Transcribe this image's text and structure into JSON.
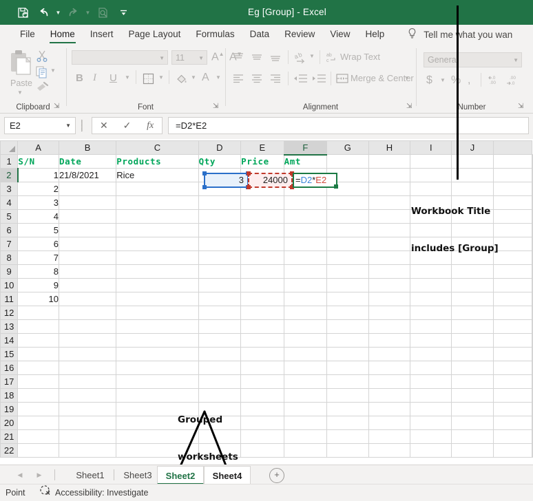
{
  "titlebar": {
    "title": "Eg [Group] - Excel",
    "qat": [
      {
        "name": "save-icon",
        "glyph": "save"
      },
      {
        "name": "undo-icon",
        "glyph": "undo"
      },
      {
        "name": "redo-icon",
        "glyph": "redo"
      },
      {
        "name": "print-preview-icon",
        "glyph": "preview"
      },
      {
        "name": "customize-qat-icon",
        "glyph": "more"
      }
    ]
  },
  "ribbon": {
    "tabs": [
      {
        "label": "File",
        "active": false
      },
      {
        "label": "Home",
        "active": true
      },
      {
        "label": "Insert",
        "active": false
      },
      {
        "label": "Page Layout",
        "active": false
      },
      {
        "label": "Formulas",
        "active": false
      },
      {
        "label": "Data",
        "active": false
      },
      {
        "label": "Review",
        "active": false
      },
      {
        "label": "View",
        "active": false
      },
      {
        "label": "Help",
        "active": false
      }
    ],
    "tellme": "Tell me what you wan",
    "groups": {
      "clipboard": {
        "label": "Clipboard",
        "paste_label": "Paste"
      },
      "font": {
        "label": "Font",
        "font_name": "",
        "font_size": "11",
        "bold": "B",
        "italic": "I",
        "underline": "U"
      },
      "alignment": {
        "label": "Alignment",
        "wrap_text": "Wrap Text",
        "merge_center": "Merge & Center"
      },
      "number": {
        "label": "Number",
        "format": "General",
        "currency": "$",
        "percent": "%",
        "comma": ","
      }
    }
  },
  "formula_bar": {
    "name_box": "E2",
    "cancel": "✕",
    "enter": "✓",
    "insert_function": "fx",
    "formula": "=D2*E2"
  },
  "grid": {
    "columns": [
      "A",
      "B",
      "C",
      "D",
      "E",
      "F",
      "G",
      "H",
      "I",
      "J"
    ],
    "selected_column": "F",
    "selected_row": 2,
    "row_count": 22,
    "rows": [
      {
        "n": 1,
        "A": "S/N",
        "B": "Date",
        "C": "Products",
        "D": "Qty",
        "E": "Price",
        "F": "Amt",
        "header": true
      },
      {
        "n": 2,
        "A": "1",
        "B": "21/8/2021",
        "C": "Rice",
        "D": "3",
        "E": "24000",
        "F": ""
      },
      {
        "n": 3,
        "A": "2",
        "B": "",
        "C": "",
        "D": "",
        "E": "",
        "F": ""
      },
      {
        "n": 4,
        "A": "3",
        "B": "",
        "C": "",
        "D": "",
        "E": "",
        "F": ""
      },
      {
        "n": 5,
        "A": "4",
        "B": "",
        "C": "",
        "D": "",
        "E": "",
        "F": ""
      },
      {
        "n": 6,
        "A": "5",
        "B": "",
        "C": "",
        "D": "",
        "E": "",
        "F": ""
      },
      {
        "n": 7,
        "A": "6",
        "B": "",
        "C": "",
        "D": "",
        "E": "",
        "F": ""
      },
      {
        "n": 8,
        "A": "7",
        "B": "",
        "C": "",
        "D": "",
        "E": "",
        "F": ""
      },
      {
        "n": 9,
        "A": "8",
        "B": "",
        "C": "",
        "D": "",
        "E": "",
        "F": ""
      },
      {
        "n": 10,
        "A": "9",
        "B": "",
        "C": "",
        "D": "",
        "E": "",
        "F": ""
      },
      {
        "n": 11,
        "A": "10",
        "B": "",
        "C": "",
        "D": "",
        "E": "",
        "F": ""
      },
      {
        "n": 12,
        "A": "",
        "B": "",
        "C": "",
        "D": "",
        "E": "",
        "F": ""
      },
      {
        "n": 13,
        "A": "",
        "B": "",
        "C": "",
        "D": "",
        "E": "",
        "F": ""
      },
      {
        "n": 14,
        "A": "",
        "B": "",
        "C": "",
        "D": "",
        "E": "",
        "F": ""
      },
      {
        "n": 15,
        "A": "",
        "B": "",
        "C": "",
        "D": "",
        "E": "",
        "F": ""
      },
      {
        "n": 16,
        "A": "",
        "B": "",
        "C": "",
        "D": "",
        "E": "",
        "F": ""
      },
      {
        "n": 17,
        "A": "",
        "B": "",
        "C": "",
        "D": "",
        "E": "",
        "F": ""
      },
      {
        "n": 18,
        "A": "",
        "B": "",
        "C": "",
        "D": "",
        "E": "",
        "F": ""
      },
      {
        "n": 19,
        "A": "",
        "B": "",
        "C": "",
        "D": "",
        "E": "",
        "F": ""
      },
      {
        "n": 20,
        "A": "",
        "B": "",
        "C": "",
        "D": "",
        "E": "",
        "F": ""
      },
      {
        "n": 21,
        "A": "",
        "B": "",
        "C": "",
        "D": "",
        "E": "",
        "F": ""
      },
      {
        "n": 22,
        "A": "",
        "B": "",
        "C": "",
        "D": "",
        "E": "",
        "F": ""
      }
    ],
    "editing_cell": {
      "ref": "F2",
      "parts": [
        {
          "text": "=",
          "kind": "op"
        },
        {
          "text": "D2",
          "kind": "blue"
        },
        {
          "text": "*",
          "kind": "op"
        },
        {
          "text": "E2",
          "kind": "red"
        }
      ]
    },
    "reference_highlights": [
      {
        "ref": "D2",
        "color": "#2a6fc9",
        "fill": "#e8f1fb",
        "style": "solid"
      },
      {
        "ref": "E2",
        "color": "#c0392b",
        "fill": "#fdeeee",
        "style": "dashed"
      }
    ],
    "header_text_color": "#00a65a"
  },
  "annotations": [
    {
      "name": "workbook-title-annotation",
      "line1": "Workbook Title",
      "line2": "includes [Group]"
    },
    {
      "name": "grouped-worksheets-annotation",
      "line1": "Grouped",
      "line2": "worksheets"
    }
  ],
  "sheet_tabs": {
    "prev_glyph": "◀",
    "next_glyph": "▶",
    "add_glyph": "+",
    "tabs": [
      {
        "label": "Sheet1",
        "state": "normal"
      },
      {
        "label": "Sheet3",
        "state": "normal"
      },
      {
        "label": "Sheet2",
        "state": "active"
      },
      {
        "label": "Sheet4",
        "state": "grouped"
      }
    ]
  },
  "status_bar": {
    "mode": "Point",
    "accessibility": "Accessibility: Investigate"
  }
}
